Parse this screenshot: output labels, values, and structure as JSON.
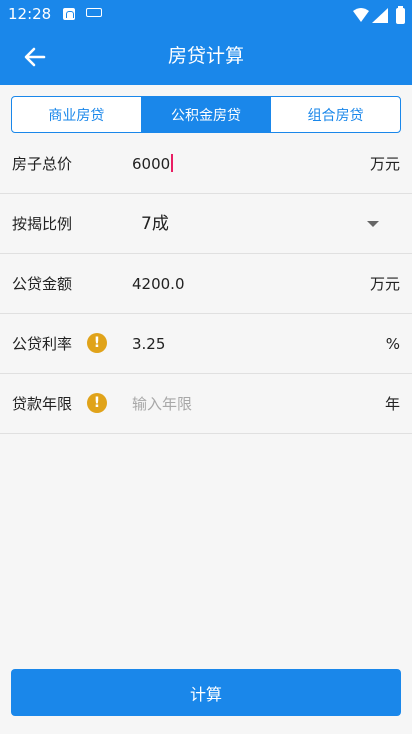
{
  "status_bar": {
    "time": "12:28"
  },
  "header": {
    "title": "房贷计算"
  },
  "tabs": [
    {
      "label": "商业房贷",
      "active": false
    },
    {
      "label": "公积金房贷",
      "active": true
    },
    {
      "label": "组合房贷",
      "active": false
    }
  ],
  "form": {
    "total_price": {
      "label": "房子总价",
      "value": "6000",
      "unit": "万元"
    },
    "down_ratio": {
      "label": "按揭比例",
      "value": "7成"
    },
    "loan_amount": {
      "label": "公贷金额",
      "value": "4200.0",
      "unit": "万元"
    },
    "rate": {
      "label": "公贷利率",
      "value": "3.25",
      "unit": "%"
    },
    "years": {
      "label": "贷款年限",
      "placeholder": "输入年限",
      "unit": "年"
    }
  },
  "calculate_button": {
    "label": "计算"
  },
  "colors": {
    "primary": "#1a87ea",
    "info": "#e0a31a",
    "caret": "#e91e63"
  },
  "icons": {
    "info": "!"
  }
}
